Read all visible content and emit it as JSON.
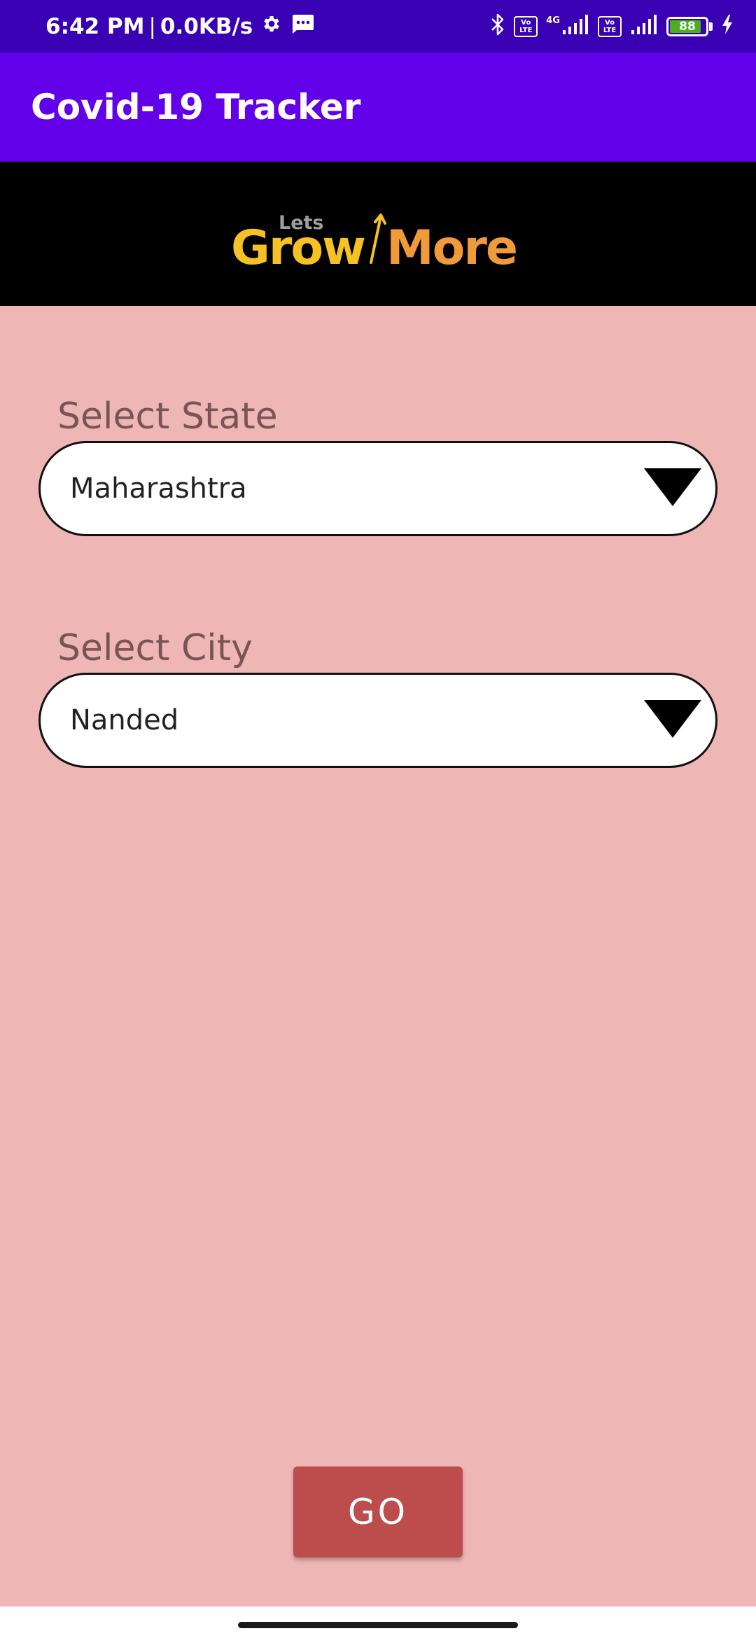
{
  "status_bar": {
    "time": "6:42 PM",
    "separator": "|",
    "net_speed": "0.0KB/s",
    "volte_label_top": "Vo",
    "volte_label_bottom": "LTE",
    "network_type": "4G",
    "battery_level": "88",
    "battery_fraction": 0.88,
    "battery_color": "#4caf20",
    "icons": [
      "settings-icon",
      "message-icon",
      "bluetooth-icon",
      "volte-icon",
      "signal-icon",
      "volte-icon",
      "signal-icon",
      "battery-icon",
      "charging-icon"
    ]
  },
  "app_bar": {
    "title": "Covid-19 Tracker",
    "color": "#6200ea"
  },
  "banner": {
    "logo_text_small": "Lets",
    "logo_text_grow": "Grow",
    "logo_text_more": "More",
    "colors": {
      "background": "#000000",
      "logo_small": "#9e9e9e",
      "logo_grow": "#f6c223",
      "logo_more": "#f09a3a"
    }
  },
  "form": {
    "background": "#efb6b6",
    "state": {
      "label": "Select State",
      "selected": "Maharashtra"
    },
    "city": {
      "label": "Select City",
      "selected": "Nanded"
    },
    "go_button_label": "GO",
    "go_button_color": "#bd4c4c"
  }
}
